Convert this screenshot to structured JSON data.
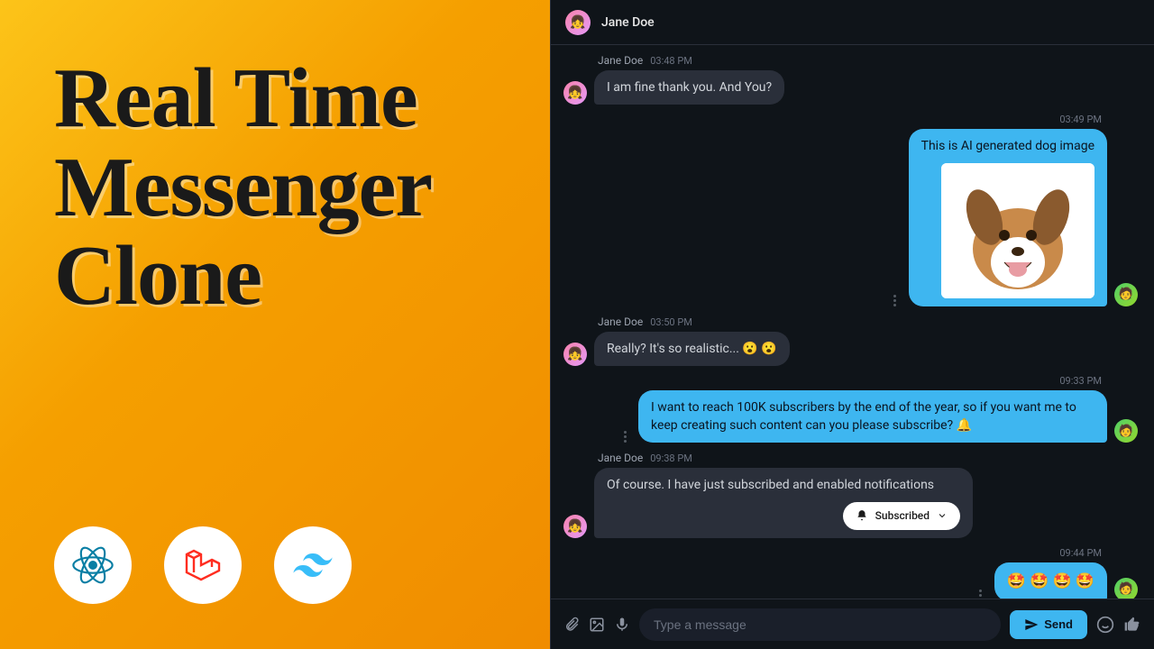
{
  "hero": {
    "title": "Real Time Messenger Clone"
  },
  "tech": {
    "react": "react-icon",
    "laravel": "laravel-icon",
    "tailwind": "tailwind-icon"
  },
  "chat": {
    "header_name": "Jane Doe",
    "messages": [
      {
        "side": "left",
        "name": "Jane Doe",
        "time": "03:48 PM",
        "text": "I am fine thank you. And You?"
      },
      {
        "side": "right",
        "time": "03:49 PM",
        "text": "This is AI generated dog image",
        "has_image": true
      },
      {
        "side": "left",
        "name": "Jane Doe",
        "time": "03:50 PM",
        "text": "Really? It's so realistic... 😮 😮"
      },
      {
        "side": "right",
        "time": "09:33 PM",
        "text": "I want to reach 100K subscribers by the end of the year, so if you want me to keep creating such content can you please subscribe? 🔔"
      },
      {
        "side": "left",
        "name": "Jane Doe",
        "time": "09:38 PM",
        "text": "Of course. I have just subscribed and enabled notifications",
        "subscribed_label": "Subscribed"
      },
      {
        "side": "right",
        "time": "09:44 PM",
        "text": "🤩 🤩 🤩 🤩"
      }
    ]
  },
  "composer": {
    "placeholder": "Type a message",
    "send_label": "Send"
  },
  "colors": {
    "accent": "#3eb6f0",
    "bg_dark": "#0f1419",
    "bubble_dark": "#2a2f3a",
    "gradient_start": "#fcc419",
    "gradient_end": "#f08c00"
  }
}
